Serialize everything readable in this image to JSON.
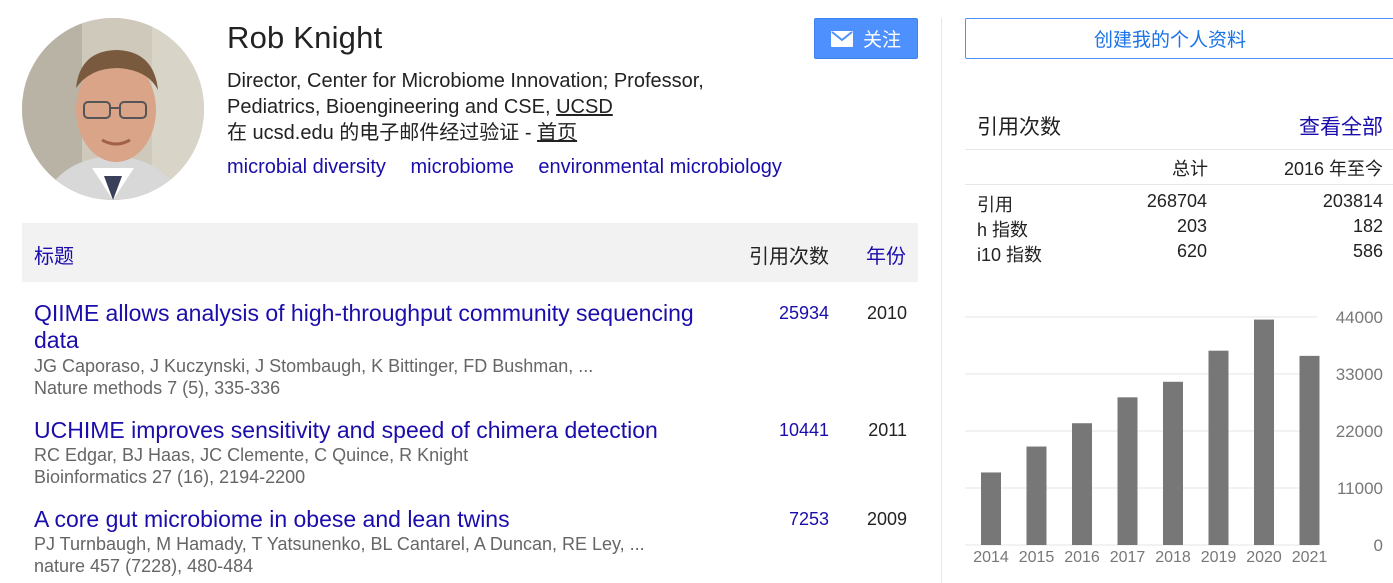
{
  "profile": {
    "name": "Rob Knight",
    "affiliation_line1": "Director, Center for Microbiome Innovation; Professor,",
    "affiliation_line2_prefix": "Pediatrics, Bioengineering and CSE, ",
    "affiliation_link": "UCSD",
    "verified_prefix": "在 ucsd.edu 的电子邮件经过验证 - ",
    "homepage_link": "首页",
    "interests": [
      "microbial diversity",
      "microbiome",
      "environmental microbiology"
    ],
    "follow_label": "关注"
  },
  "articles_table": {
    "header_title": "标题",
    "header_cited_by": "引用次数",
    "header_year": "年份",
    "rows": [
      {
        "title": "QIIME allows analysis of high-throughput community sequencing data",
        "authors": "JG Caporaso, J Kuczynski, J Stombaugh, K Bittinger, FD Bushman, ...",
        "venue": "Nature methods 7 (5), 335-336",
        "cited_by": "25934",
        "year": "2010"
      },
      {
        "title": "UCHIME improves sensitivity and speed of chimera detection",
        "authors": "RC Edgar, BJ Haas, JC Clemente, C Quince, R Knight",
        "venue": "Bioinformatics 27 (16), 2194-2200",
        "cited_by": "10441",
        "year": "2011"
      },
      {
        "title": "A core gut microbiome in obese and lean twins",
        "authors": "PJ Turnbaugh, M Hamady, T Yatsunenko, BL Cantarel, A Duncan, RE Ley, ...",
        "venue": "nature 457 (7228), 480-484",
        "cited_by": "7253",
        "year": "2009"
      }
    ]
  },
  "sidebar": {
    "create_profile_label": "创建我的个人资料",
    "stats_title": "引用次数",
    "view_all_label": "查看全部",
    "col_all": "总计",
    "col_since": "2016 年至今",
    "stats": [
      {
        "label": "引用",
        "all": "268704",
        "since": "203814"
      },
      {
        "label": "h 指数",
        "all": "203",
        "since": "182"
      },
      {
        "label": "i10 指数",
        "all": "620",
        "since": "586"
      }
    ]
  },
  "colors": {
    "link": "#1a0dab",
    "button": "#4d90fe",
    "bar": "#777777"
  },
  "chart_data": {
    "type": "bar",
    "categories": [
      "2014",
      "2015",
      "2016",
      "2017",
      "2018",
      "2019",
      "2020",
      "2021"
    ],
    "values": [
      14000,
      19000,
      23500,
      28500,
      31500,
      37500,
      43500,
      36500
    ],
    "yticks": [
      "44000",
      "33000",
      "22000",
      "11000",
      "0"
    ],
    "ylim": [
      0,
      44000
    ],
    "grid": true
  }
}
